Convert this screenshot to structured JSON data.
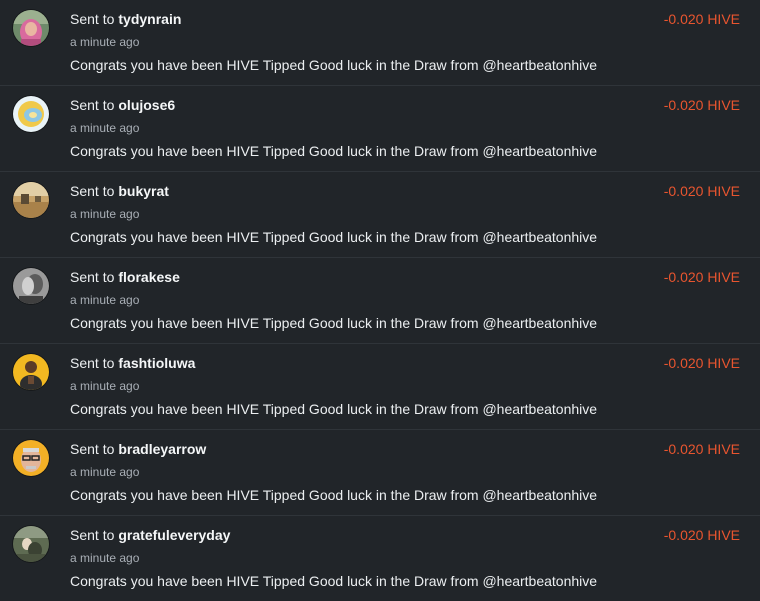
{
  "colors": {
    "background": "#212529",
    "text": "#eceff1",
    "muted": "#a9afb6",
    "amount": "#e8552f",
    "separator": "#2f3439"
  },
  "transactions": [
    {
      "sent_prefix": "Sent to",
      "recipient": "tydynrain",
      "time": "a minute ago",
      "memo": "Congrats you have been HIVE Tipped Good luck in the Draw from @heartbeatonhive",
      "amount": "-0.020 HIVE",
      "avatar_icon": "avatar-pink-hair-icon"
    },
    {
      "sent_prefix": "Sent to",
      "recipient": "olujose6",
      "time": "a minute ago",
      "memo": "Congrats you have been HIVE Tipped Good luck in the Draw from @heartbeatonhive",
      "amount": "-0.020 HIVE",
      "avatar_icon": "avatar-yellow-blue-icon"
    },
    {
      "sent_prefix": "Sent to",
      "recipient": "bukyrat",
      "time": "a minute ago",
      "memo": "Congrats you have been HIVE Tipped Good luck in the Draw from @heartbeatonhive",
      "amount": "-0.020 HIVE",
      "avatar_icon": "avatar-landscape-icon"
    },
    {
      "sent_prefix": "Sent to",
      "recipient": "florakese",
      "time": "a minute ago",
      "memo": "Congrats you have been HIVE Tipped Good luck in the Draw from @heartbeatonhive",
      "amount": "-0.020 HIVE",
      "avatar_icon": "avatar-grey-portrait-icon"
    },
    {
      "sent_prefix": "Sent to",
      "recipient": "fashtioluwa",
      "time": "a minute ago",
      "memo": "Congrats you have been HIVE Tipped Good luck in the Draw from @heartbeatonhive",
      "amount": "-0.020 HIVE",
      "avatar_icon": "avatar-yellow-person-icon"
    },
    {
      "sent_prefix": "Sent to",
      "recipient": "bradleyarrow",
      "time": "a minute ago",
      "memo": "Congrats you have been HIVE Tipped Good luck in the Draw from @heartbeatonhive",
      "amount": "-0.020 HIVE",
      "avatar_icon": "avatar-glasses-man-icon"
    },
    {
      "sent_prefix": "Sent to",
      "recipient": "gratefuleveryday",
      "time": "a minute ago",
      "memo": "Congrats you have been HIVE Tipped Good luck in the Draw from @heartbeatonhive",
      "amount": "-0.020 HIVE",
      "avatar_icon": "avatar-outdoor-photo-icon"
    }
  ]
}
